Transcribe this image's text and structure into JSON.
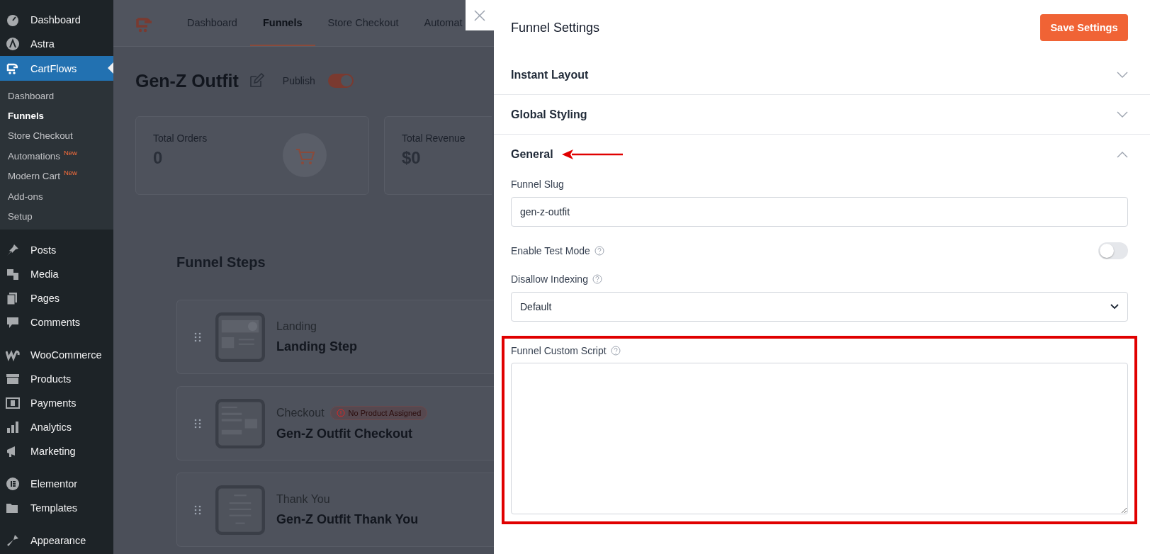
{
  "sidebar": {
    "groups": [
      [
        {
          "label": "Dashboard",
          "selected": false
        },
        {
          "label": "Astra",
          "selected": false
        },
        {
          "label": "CartFlows",
          "selected": true,
          "submenu": [
            {
              "label": "Dashboard",
              "selected": false
            },
            {
              "label": "Funnels",
              "selected": true
            },
            {
              "label": "Store Checkout",
              "selected": false
            },
            {
              "label": "Automations",
              "badge": "New",
              "selected": false
            },
            {
              "label": "Modern Cart",
              "badge": "New",
              "selected": false
            },
            {
              "label": "Add-ons",
              "selected": false
            },
            {
              "label": "Setup",
              "selected": false
            }
          ]
        }
      ],
      [
        {
          "label": "Posts",
          "selected": false
        },
        {
          "label": "Media",
          "selected": false
        },
        {
          "label": "Pages",
          "selected": false
        },
        {
          "label": "Comments",
          "selected": false
        }
      ],
      [
        {
          "label": "WooCommerce",
          "selected": false
        },
        {
          "label": "Products",
          "selected": false
        },
        {
          "label": "Payments",
          "selected": false
        },
        {
          "label": "Analytics",
          "selected": false
        },
        {
          "label": "Marketing",
          "selected": false
        }
      ],
      [
        {
          "label": "Elementor",
          "selected": false
        },
        {
          "label": "Templates",
          "selected": false
        }
      ],
      [
        {
          "label": "Appearance",
          "selected": false
        }
      ]
    ]
  },
  "main": {
    "tabs": [
      {
        "label": "Dashboard",
        "selected": false
      },
      {
        "label": "Funnels",
        "selected": true
      },
      {
        "label": "Store Checkout",
        "selected": false
      },
      {
        "label": "Automat",
        "selected": false
      }
    ],
    "funnel_title": "Gen-Z Outfit",
    "status_label": "Publish",
    "published": true,
    "stats": [
      {
        "label": "Total Orders",
        "value": "0"
      },
      {
        "label": "Total Revenue",
        "value": "$0"
      }
    ],
    "steps_heading": "Funnel Steps",
    "steps": [
      {
        "type": "Landing",
        "title": "Landing Step"
      },
      {
        "type": "Checkout",
        "title": "Gen-Z Outfit Checkout",
        "badge": "No Product Assigned"
      },
      {
        "type": "Thank You",
        "title": "Gen-Z Outfit Thank You"
      }
    ]
  },
  "drawer": {
    "title": "Funnel Settings",
    "save_button": "Save Settings",
    "sections": [
      {
        "title": "Instant Layout",
        "expanded": false,
        "arrow": false
      },
      {
        "title": "Global Styling",
        "expanded": false,
        "arrow": false
      },
      {
        "title": "General",
        "expanded": true,
        "arrow": true
      }
    ],
    "fields": [
      {
        "kind": "text",
        "label": "Funnel Slug",
        "help": false,
        "value": "gen-z-outfit",
        "highlighted": false
      },
      {
        "kind": "toggle",
        "label": "Enable Test Mode",
        "help": true,
        "on": false,
        "highlighted": false
      },
      {
        "kind": "select",
        "label": "Disallow Indexing",
        "help": true,
        "value": "Default",
        "highlighted": false
      },
      {
        "kind": "textarea",
        "label": "Funnel Custom Script",
        "help": true,
        "highlighted": true
      }
    ]
  }
}
